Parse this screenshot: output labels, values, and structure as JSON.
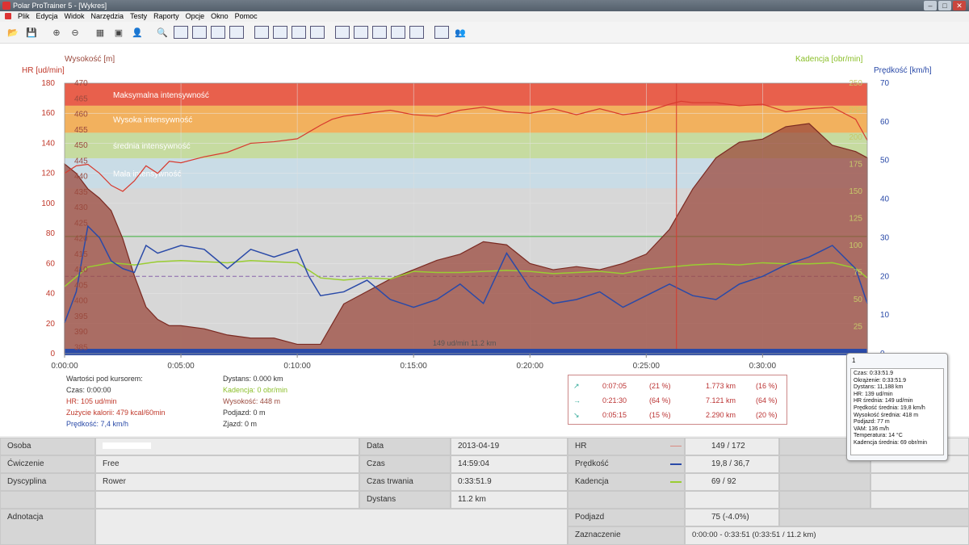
{
  "window": {
    "title": "Polar ProTrainer 5 - [Wykres]"
  },
  "menu": [
    "Plik",
    "Edycja",
    "Widok",
    "Narzędzia",
    "Testy",
    "Raporty",
    "Opcje",
    "Okno",
    "Pomoc"
  ],
  "toolbar_icons": [
    "open-folder-icon",
    "save-icon",
    "add-icon",
    "remove-icon",
    "calendar-icon",
    "book-icon",
    "user-icon",
    "zoom-icon",
    "zoom-1-1-icon",
    "compare-icon",
    "lap-icon",
    "swim-icon",
    "hr-curve-icon",
    "bar-chart-icon",
    "percent-icon",
    "settings-icon",
    "graph-1-icon",
    "graph-2-icon",
    "graph-3-icon",
    "graph-4-icon",
    "graph-5-icon",
    "report-icon",
    "people-icon"
  ],
  "chart": {
    "hr_axis_label": "HR [ud/min]",
    "altitude_axis_label": "Wysokość [m]",
    "cadence_axis_label": "Kadencja [obr/min]",
    "speed_axis_label": "Prędkość [km/h]",
    "hr_ticks": [
      "0",
      "20",
      "40",
      "60",
      "80",
      "100",
      "120",
      "140",
      "160",
      "180"
    ],
    "alt_ticks": [
      "385",
      "390",
      "395",
      "400",
      "405",
      "410",
      "415",
      "420",
      "425",
      "430",
      "435",
      "440",
      "445",
      "450",
      "455",
      "460",
      "465",
      "470"
    ],
    "cadence_ticks": [
      "25",
      "50",
      "75",
      "100",
      "125",
      "150",
      "175",
      "200",
      "225",
      "250"
    ],
    "speed_ticks": [
      "0",
      "10",
      "20",
      "30",
      "40",
      "50",
      "60",
      "70"
    ],
    "time_ticks": [
      "0:00:00",
      "0:05:00",
      "0:10:00",
      "0:15:00",
      "0:20:00",
      "0:25:00",
      "0:30:00"
    ],
    "zones": [
      {
        "name": "Maksymalna intensywność",
        "from": 165,
        "to": 180,
        "color": "#e8604c"
      },
      {
        "name": "Wysoka intensywność",
        "from": 147,
        "to": 165,
        "color": "#f2b15e"
      },
      {
        "name": "średnia intensywność",
        "from": 130,
        "to": 147,
        "color": "#c6dba0"
      },
      {
        "name": "Mała intensywność",
        "from": 110,
        "to": 130,
        "color": "#c9dce6"
      }
    ],
    "avg_label": "149 ud/min 11.2 km",
    "colors": {
      "hr": "#d83a2e",
      "altitude_fill": "#9b4a3e",
      "speed": "#2a4aa8",
      "cadence": "#9acd32",
      "bg": "#d7d7d7"
    }
  },
  "chart_data": {
    "type": "line",
    "xlabel": "",
    "xlim_min": [
      0,
      34.5
    ],
    "series": [
      {
        "name": "HR [ud/min]",
        "axis": "hr",
        "x": [
          0,
          0.5,
          1,
          1.5,
          2,
          2.5,
          3,
          3.5,
          4,
          4.5,
          5,
          6,
          7,
          8,
          9,
          10,
          11,
          11.5,
          12,
          13,
          14,
          15,
          16,
          17,
          18,
          19,
          20,
          21,
          22,
          23,
          24,
          25,
          26,
          26.5,
          27,
          28,
          29,
          30,
          31,
          32,
          33,
          34,
          34.5
        ],
        "y": [
          120,
          125,
          126,
          120,
          112,
          108,
          115,
          125,
          120,
          128,
          127,
          131,
          134,
          140,
          141,
          143,
          152,
          156,
          158,
          160,
          162,
          159,
          158,
          162,
          164,
          161,
          160,
          163,
          159,
          163,
          159,
          161,
          166,
          168,
          167,
          167,
          165,
          166,
          161,
          163,
          164,
          156,
          142
        ]
      },
      {
        "name": "Wysokość [m]",
        "axis": "alt",
        "x": [
          0,
          0.5,
          1,
          1.5,
          2,
          2.5,
          3,
          3.5,
          4,
          4.5,
          5,
          6,
          7,
          8,
          9,
          10,
          11,
          12,
          13,
          14,
          15,
          16,
          17,
          18,
          19,
          20,
          21,
          22,
          23,
          24,
          25,
          26,
          27,
          28,
          29,
          30,
          31,
          32,
          33,
          34,
          34.5
        ],
        "y": [
          444,
          441,
          436,
          433,
          429,
          420,
          408,
          398,
          394,
          392,
          392,
          391,
          389,
          388,
          388,
          386,
          386,
          399,
          403,
          407,
          410,
          413,
          415,
          419,
          418,
          412,
          410,
          411,
          410,
          412,
          415,
          423,
          436,
          446,
          451,
          452,
          456,
          457,
          450,
          448,
          446
        ]
      },
      {
        "name": "Prędkość [km/h]",
        "axis": "speed",
        "x": [
          0,
          0.5,
          1,
          1.5,
          2,
          2.5,
          3,
          3.5,
          4,
          5,
          6,
          7,
          8,
          9,
          10,
          10.5,
          11,
          12,
          13,
          14,
          15,
          16,
          17,
          18,
          19,
          20,
          21,
          22,
          23,
          24,
          25,
          26,
          27,
          28,
          29,
          30,
          31,
          32,
          33,
          34,
          34.5
        ],
        "y": [
          8,
          16,
          33,
          30,
          24,
          22,
          21,
          28,
          26,
          28,
          27,
          22,
          27,
          25,
          27,
          20,
          15,
          16,
          19,
          14,
          12,
          14,
          18,
          13,
          26,
          17,
          13,
          14,
          16,
          12,
          15,
          18,
          15,
          14,
          18,
          20,
          23,
          25,
          28,
          22,
          13
        ]
      },
      {
        "name": "Kadencja [obr/min]",
        "axis": "cadence",
        "x": [
          0,
          1,
          2,
          3,
          4,
          5,
          6,
          7,
          8,
          9,
          10,
          11,
          12,
          13,
          14,
          15,
          16,
          17,
          18,
          19,
          20,
          21,
          22,
          23,
          24,
          25,
          26,
          27,
          28,
          29,
          30,
          31,
          32,
          33,
          34,
          34.5
        ],
        "y": [
          62,
          80,
          84,
          82,
          85,
          86,
          85,
          84,
          86,
          85,
          84,
          70,
          68,
          70,
          69,
          76,
          75,
          75,
          76,
          77,
          76,
          74,
          75,
          76,
          74,
          78,
          80,
          82,
          83,
          82,
          84,
          83,
          83,
          84,
          79,
          70
        ]
      }
    ],
    "hr_ylim": [
      0,
      180
    ],
    "alt_ylim": [
      383,
      470
    ],
    "speed_ylim": [
      0,
      70
    ],
    "cadence_ylim": [
      0,
      250
    ],
    "cursor_time_min": 26.3,
    "hr_reference_line": 78
  },
  "cursor": {
    "heading": "Wartości pod kursorem:",
    "time": "Czas: 0:00:00",
    "hr": "HR: 105 ud/min",
    "kcal": "Zużycie kalorii: 479 kcal/60min",
    "speed": "Prędkość: 7,4 km/h",
    "distance": "Dystans: 0.000 km",
    "cadence": "Kadencja: 0 obr/min",
    "altitude": "Wysokość: 448 m",
    "ascent": "Podjazd: 0 m",
    "descent": "Zjazd: 0 m"
  },
  "zones_summary": [
    {
      "icon": "↗",
      "time": "0:07:05",
      "pct": "(21 %)",
      "dist": "1.773 km",
      "dpct": "(16 %)"
    },
    {
      "icon": "→",
      "time": "0:21:30",
      "pct": "(64 %)",
      "dist": "7.121 km",
      "dpct": "(64 %)"
    },
    {
      "icon": "↘",
      "time": "0:05:15",
      "pct": "(15 %)",
      "dist": "2.290 km",
      "dpct": "(20 %)"
    }
  ],
  "popup": {
    "num": "1",
    "lines": [
      "Czas: 0:33:51.9",
      "Okrążenie: 0:33:51.9",
      "Dystans: 11,188 km",
      "HR: 139 ud/min",
      "HR średnia: 149 ud/min",
      "Prędkość średnia: 19,8 km/h",
      "Wysokość średnia: 418 m",
      "Podjazd: 77 m",
      "VAM: 136 m/h",
      "Temperatura: 14 °C",
      "Kadencja średnia: 69 obr/min"
    ]
  },
  "summary": {
    "osoba_label": "Osoba",
    "cwiczenie_label": "Ćwiczenie",
    "cwiczenie": "Free",
    "dyscyplina_label": "Dyscyplina",
    "dyscyplina": "Rower",
    "adnotacja_label": "Adnotacja",
    "data_label": "Data",
    "data": "2013-04-19",
    "czas_label": "Czas",
    "czas": "14:59:04",
    "czas_trwania_label": "Czas trwania",
    "czas_trwania": "0:33:51.9",
    "dystans_label": "Dystans",
    "dystans": "11.2 km",
    "hr_label": "HR",
    "hr": "149 / 172",
    "predkosc_label": "Prędkość",
    "predkosc": "19,8 / 36,7",
    "kadencja_label": "Kadencja",
    "kadencja": "69 / 92",
    "podjazd_label": "Podjazd",
    "podjazd": "75 (-4.0%)",
    "zaznaczenie_label": "Zaznaczenie",
    "zaznaczenie": "0:00:00 - 0:33:51 (0:33:51 / 11.2 km)"
  }
}
